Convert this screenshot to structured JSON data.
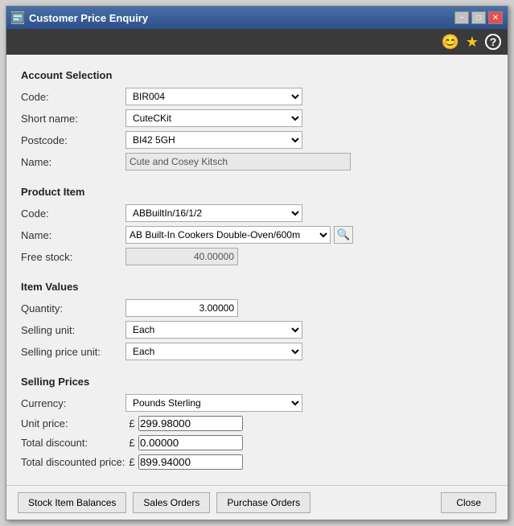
{
  "window": {
    "title": "Customer Price Enquiry",
    "icon": "app-icon",
    "min_btn": "−",
    "max_btn": "□",
    "close_btn": "✕"
  },
  "toolbar": {
    "smiley_icon": "😊",
    "star_icon": "★",
    "help_icon": "?"
  },
  "account_selection": {
    "section_title": "Account Selection",
    "code_label": "Code:",
    "code_value": "BIR004",
    "shortname_label": "Short name:",
    "shortname_value": "CuteCKit",
    "postcode_label": "Postcode:",
    "postcode_value": "BI42 5GH",
    "name_label": "Name:",
    "name_value": "Cute and Cosey Kitsch"
  },
  "product_item": {
    "section_title": "Product Item",
    "code_label": "Code:",
    "code_value": "ABBuiltIn/16/1/2",
    "name_label": "Name:",
    "name_value": "AB Built-In Cookers Double-Oven/600m",
    "freestock_label": "Free stock:",
    "freestock_value": "40.00000"
  },
  "item_values": {
    "section_title": "Item Values",
    "quantity_label": "Quantity:",
    "quantity_value": "3.00000",
    "selling_unit_label": "Selling unit:",
    "selling_unit_value": "Each",
    "selling_price_unit_label": "Selling price unit:",
    "selling_price_unit_value": "Each"
  },
  "selling_prices": {
    "section_title": "Selling Prices",
    "currency_label": "Currency:",
    "currency_value": "Pounds Sterling",
    "unit_price_label": "Unit price:",
    "unit_price_symbol": "£",
    "unit_price_value": "299.98000",
    "total_discount_label": "Total discount:",
    "total_discount_symbol": "£",
    "total_discount_value": "0.00000",
    "total_discounted_label": "Total discounted price:",
    "total_discounted_symbol": "£",
    "total_discounted_value": "899.94000"
  },
  "footer": {
    "stock_btn": "Stock Item Balances",
    "sales_btn": "Sales Orders",
    "purchase_btn": "Purchase Orders",
    "close_btn": "Close"
  }
}
